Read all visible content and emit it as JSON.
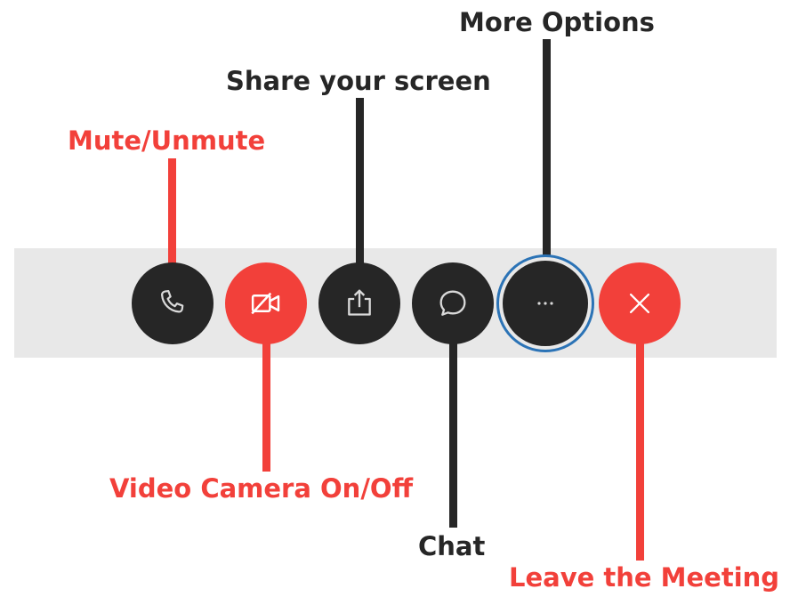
{
  "labels": {
    "mute": "Mute/Unmute",
    "video": "Video Camera On/Off",
    "share": "Share your screen",
    "chat": "Chat",
    "more": "More Options",
    "leave": "Leave the Meeting"
  },
  "buttons": [
    {
      "name": "mute-button",
      "icon": "phone-icon"
    },
    {
      "name": "video-button",
      "icon": "video-camera-off-icon"
    },
    {
      "name": "share-screen-button",
      "icon": "share-upload-icon"
    },
    {
      "name": "chat-button",
      "icon": "chat-bubble-icon"
    },
    {
      "name": "more-options-button",
      "icon": "ellipsis-icon"
    },
    {
      "name": "leave-meeting-button",
      "icon": "close-x-icon"
    }
  ],
  "colors": {
    "accent_red": "#f2403a",
    "dark": "#262626",
    "toolbar_bg": "#e8e8e8",
    "focus_ring": "#2b73b6"
  }
}
